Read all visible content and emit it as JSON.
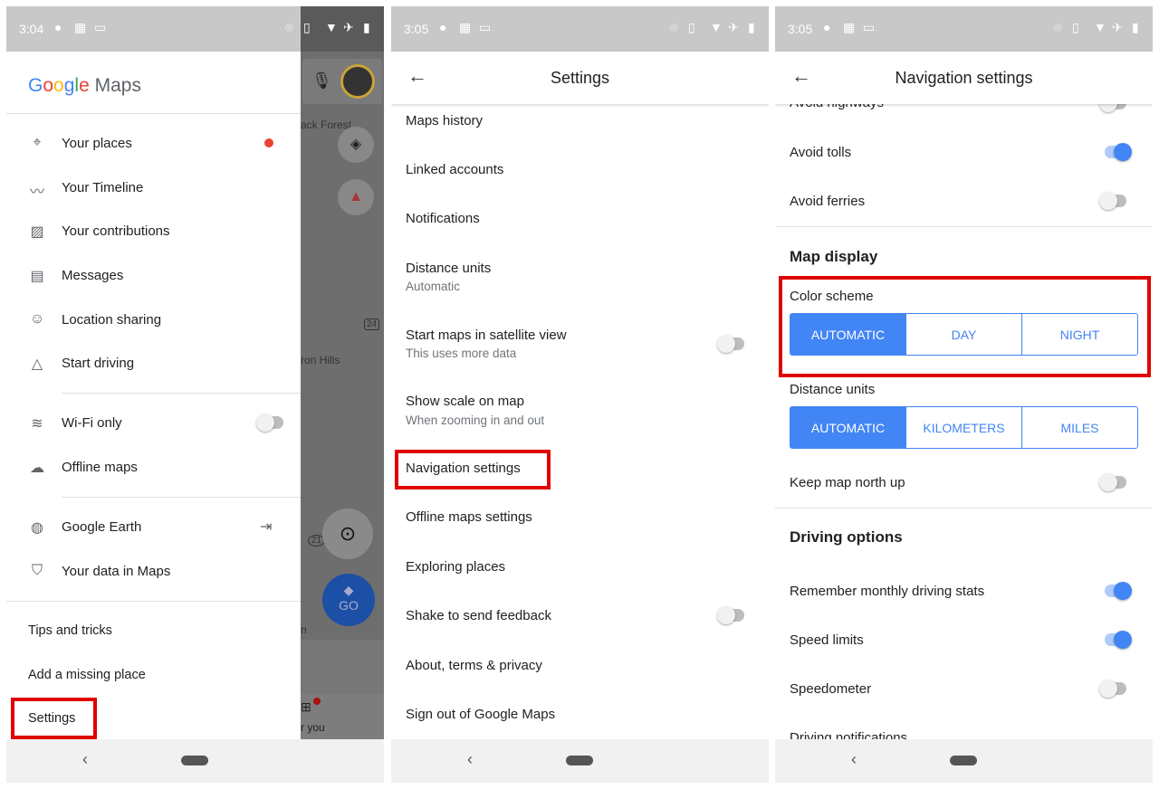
{
  "panel1": {
    "status_time": "3:04",
    "logo_google": "Google",
    "logo_maps": "Maps",
    "items": [
      {
        "label": "Your places",
        "icon": "location-pin-icon"
      },
      {
        "label": "Your Timeline",
        "icon": "timeline-icon"
      },
      {
        "label": "Your contributions",
        "icon": "contributions-icon"
      },
      {
        "label": "Messages",
        "icon": "messages-icon"
      },
      {
        "label": "Location sharing",
        "icon": "location-sharing-icon"
      },
      {
        "label": "Start driving",
        "icon": "navigation-icon"
      },
      {
        "label": "Wi-Fi only",
        "icon": "wifi-icon"
      },
      {
        "label": "Offline maps",
        "icon": "offline-icon"
      },
      {
        "label": "Google Earth",
        "icon": "earth-icon"
      },
      {
        "label": "Your data in Maps",
        "icon": "shield-icon"
      }
    ],
    "wifi_only_enabled": false,
    "footer": [
      "Tips and tricks",
      "Add a missing place",
      "Settings"
    ],
    "map_labels": {
      "forest": "ack Forest",
      "hills": "ron Hills",
      "route24": "24",
      "route21": "21",
      "go": "GO",
      "for_you": "r you",
      "in": "n"
    },
    "accent_dot": "#ea4335"
  },
  "panel2": {
    "status_time": "3:05",
    "title": "Settings",
    "items": [
      {
        "label": "Maps history"
      },
      {
        "label": "Linked accounts"
      },
      {
        "label": "Notifications"
      },
      {
        "label": "Distance units",
        "sub": "Automatic"
      },
      {
        "label": "Start maps in satellite view",
        "sub": "This uses more data",
        "toggle": false
      },
      {
        "label": "Show scale on map",
        "sub": "When zooming in and out"
      },
      {
        "label": "Navigation settings"
      },
      {
        "label": "Offline maps settings"
      },
      {
        "label": "Exploring places"
      },
      {
        "label": "Shake to send feedback",
        "toggle": false
      },
      {
        "label": "About, terms & privacy"
      },
      {
        "label": "Sign out of Google Maps"
      }
    ]
  },
  "panel3": {
    "status_time": "3:05",
    "title": "Navigation settings",
    "route_options": [
      {
        "label": "Avoid highways",
        "on": false
      },
      {
        "label": "Avoid tolls",
        "on": true
      },
      {
        "label": "Avoid ferries",
        "on": false
      }
    ],
    "map_display": "Map display",
    "color_scheme": {
      "label": "Color scheme",
      "options": [
        "AUTOMATIC",
        "DAY",
        "NIGHT"
      ],
      "selected": "AUTOMATIC"
    },
    "distance_units": {
      "label": "Distance units",
      "options": [
        "AUTOMATIC",
        "KILOMETERS",
        "MILES"
      ],
      "selected": "AUTOMATIC"
    },
    "keep_north": {
      "label": "Keep map north up",
      "on": false
    },
    "driving_options": "Driving options",
    "driving": [
      {
        "label": "Remember monthly driving stats",
        "on": true
      },
      {
        "label": "Speed limits",
        "on": true
      },
      {
        "label": "Speedometer",
        "on": false
      },
      {
        "label": "Driving notifications"
      }
    ]
  },
  "colors": {
    "accent": "#4285f4",
    "highlight": "#e00000",
    "status_bar": "#c8c8c8"
  }
}
